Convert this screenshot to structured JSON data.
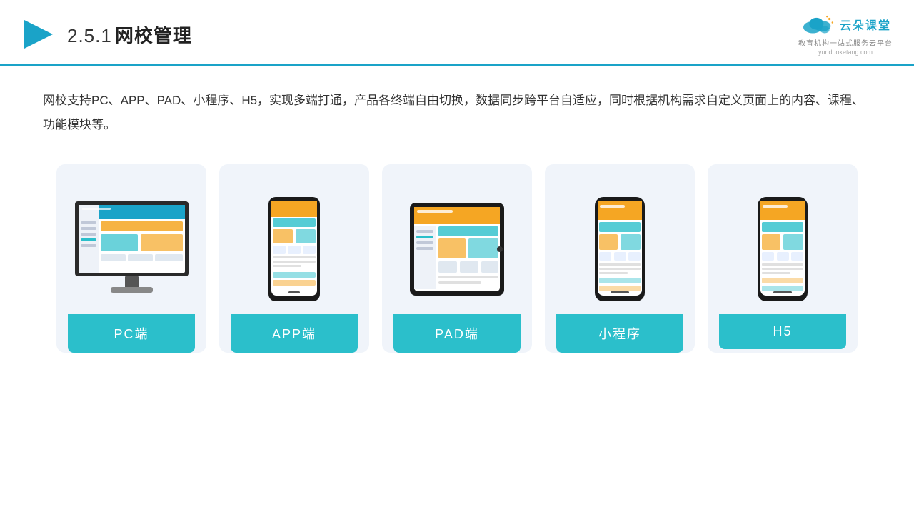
{
  "header": {
    "section_num": "2.5.1",
    "title": "网校管理",
    "logo_name": "云朵课堂",
    "logo_tagline": "教育机构一站\n式服务云平台",
    "logo_url": "yunduoketang.com"
  },
  "description": {
    "text": "网校支持PC、APP、PAD、小程序、H5，实现多端打通，产品各终端自由切换，数据同步跨平台自适应，同时根据机构需求自定义页面上的内容、课程、功能模块等。"
  },
  "cards": [
    {
      "id": "pc",
      "label": "PC端",
      "type": "monitor"
    },
    {
      "id": "app",
      "label": "APP端",
      "type": "phone"
    },
    {
      "id": "pad",
      "label": "PAD端",
      "type": "tablet"
    },
    {
      "id": "miniprogram",
      "label": "小程序",
      "type": "phone"
    },
    {
      "id": "h5",
      "label": "H5",
      "type": "phone"
    }
  ],
  "colors": {
    "accent": "#2bbfcb",
    "title": "#1aa3c8",
    "text": "#333333"
  }
}
